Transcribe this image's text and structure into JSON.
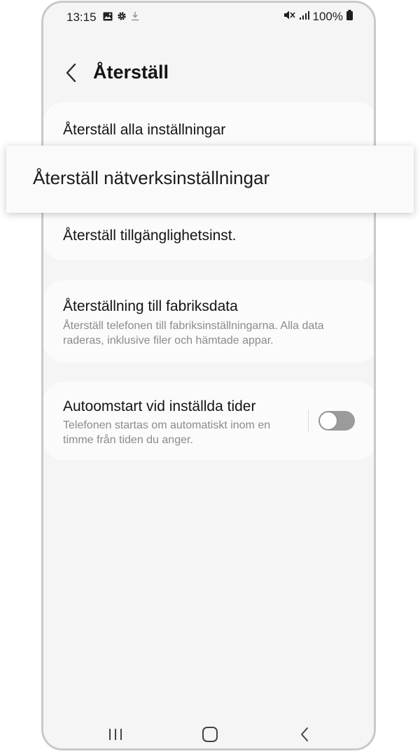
{
  "status_bar": {
    "time": "13:15",
    "battery": "100%",
    "icons_left": [
      "gallery-icon",
      "gear-icon",
      "download-icon"
    ],
    "icons_right": [
      "mute-icon",
      "signal-icon",
      "battery-icon"
    ]
  },
  "header": {
    "title": "Återställ",
    "back_icon": "chevron-left-icon"
  },
  "menu": {
    "reset_all": "Återställ alla inställningar",
    "reset_network": "Återställ nätverksinställningar",
    "reset_accessibility": "Återställ tillgänglighetsinst.",
    "factory_reset": {
      "title": "Återställning till fabriksdata",
      "description": "Återställ telefonen till fabriksinställningarna. Alla data raderas, inklusive filer och hämtade appar."
    },
    "auto_restart": {
      "title": "Autoomstart vid inställda tider",
      "description": "Telefonen startas om automatiskt inom en timme från tiden du anger.",
      "enabled": false
    }
  },
  "nav_bar": {
    "icons": [
      "recent-apps-icon",
      "home-icon",
      "back-icon"
    ]
  },
  "colors": {
    "background": "#f5f5f5",
    "card": "#fbfbfb",
    "text": "#141414",
    "subtext": "#8b8b8b",
    "toggle_off": "#9b9b9b"
  }
}
